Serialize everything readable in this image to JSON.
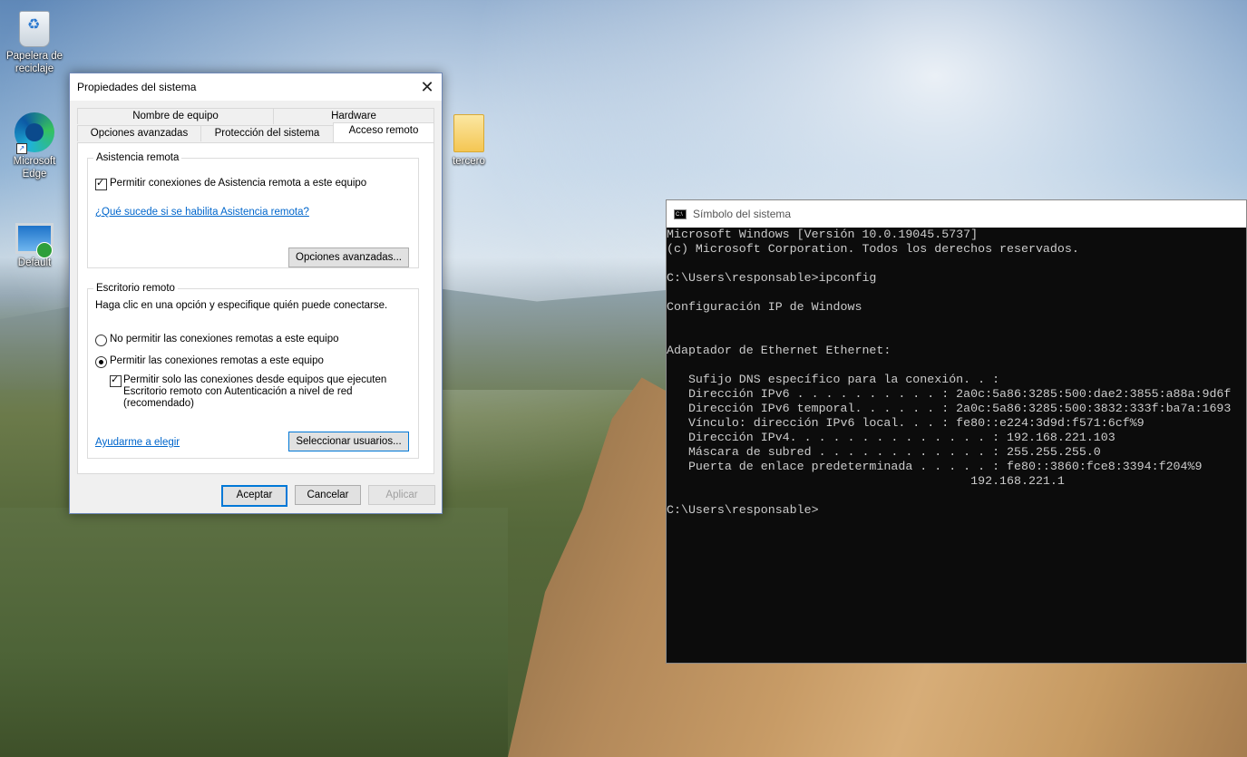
{
  "desktop": {
    "icons": [
      {
        "label": "Papelera de reciclaje",
        "icon": "recycle-bin-icon"
      },
      {
        "label": "Microsoft Edge",
        "icon": "edge-icon"
      },
      {
        "label": "Default",
        "icon": "remote-desktop-icon"
      },
      {
        "label": "tercero",
        "icon": "folder-icon"
      }
    ]
  },
  "dialog": {
    "title": "Propiedades del sistema",
    "tabs_row1": [
      "Nombre de equipo",
      "Hardware"
    ],
    "tabs_row2": [
      "Opciones avanzadas",
      "Protección del sistema",
      "Acceso remoto"
    ],
    "active_tab": "Acceso remoto",
    "remote_assistance": {
      "legend": "Asistencia remota",
      "allow_label": "Permitir conexiones de Asistencia remota a este equipo",
      "allow_checked": true,
      "help_link": "¿Qué sucede si se habilita Asistencia remota?",
      "advanced_button": "Opciones avanzadas..."
    },
    "remote_desktop": {
      "legend": "Escritorio remoto",
      "instruction": "Haga clic en una opción y especifique quién puede conectarse.",
      "option_deny": "No permitir las conexiones remotas a este equipo",
      "option_allow": "Permitir las conexiones remotas a este equipo",
      "selected": "allow",
      "nla_line1": "Permitir solo las conexiones desde equipos que ejecuten",
      "nla_line2": "Escritorio remoto con Autenticación a nivel de red",
      "nla_line3": "(recomendado)",
      "nla_checked": true,
      "help_link": "Ayudarme a elegir",
      "select_users_button": "Seleccionar usuarios..."
    },
    "buttons": {
      "ok": "Aceptar",
      "cancel": "Cancelar",
      "apply": "Aplicar"
    }
  },
  "cmd": {
    "title": "Símbolo del sistema",
    "icon_text": "C:\\",
    "output": "Microsoft Windows [Versión 10.0.19045.5737]\n(c) Microsoft Corporation. Todos los derechos reservados.\n\nC:\\Users\\responsable>ipconfig\n\nConfiguración IP de Windows\n\n\nAdaptador de Ethernet Ethernet:\n\n   Sufijo DNS específico para la conexión. . :\n   Dirección IPv6 . . . . . . . . . . : 2a0c:5a86:3285:500:dae2:3855:a88a:9d6f\n   Dirección IPv6 temporal. . . . . . : 2a0c:5a86:3285:500:3832:333f:ba7a:1693\n   Vínculo: dirección IPv6 local. . . : fe80::e224:3d9d:f571:6cf%9\n   Dirección IPv4. . . . . . . . . . . . . . : 192.168.221.103\n   Máscara de subred . . . . . . . . . . . . : 255.255.255.0\n   Puerta de enlace predeterminada . . . . . : fe80::3860:fce8:3394:f204%9\n                                          192.168.221.1\n\nC:\\Users\\responsable>"
  }
}
